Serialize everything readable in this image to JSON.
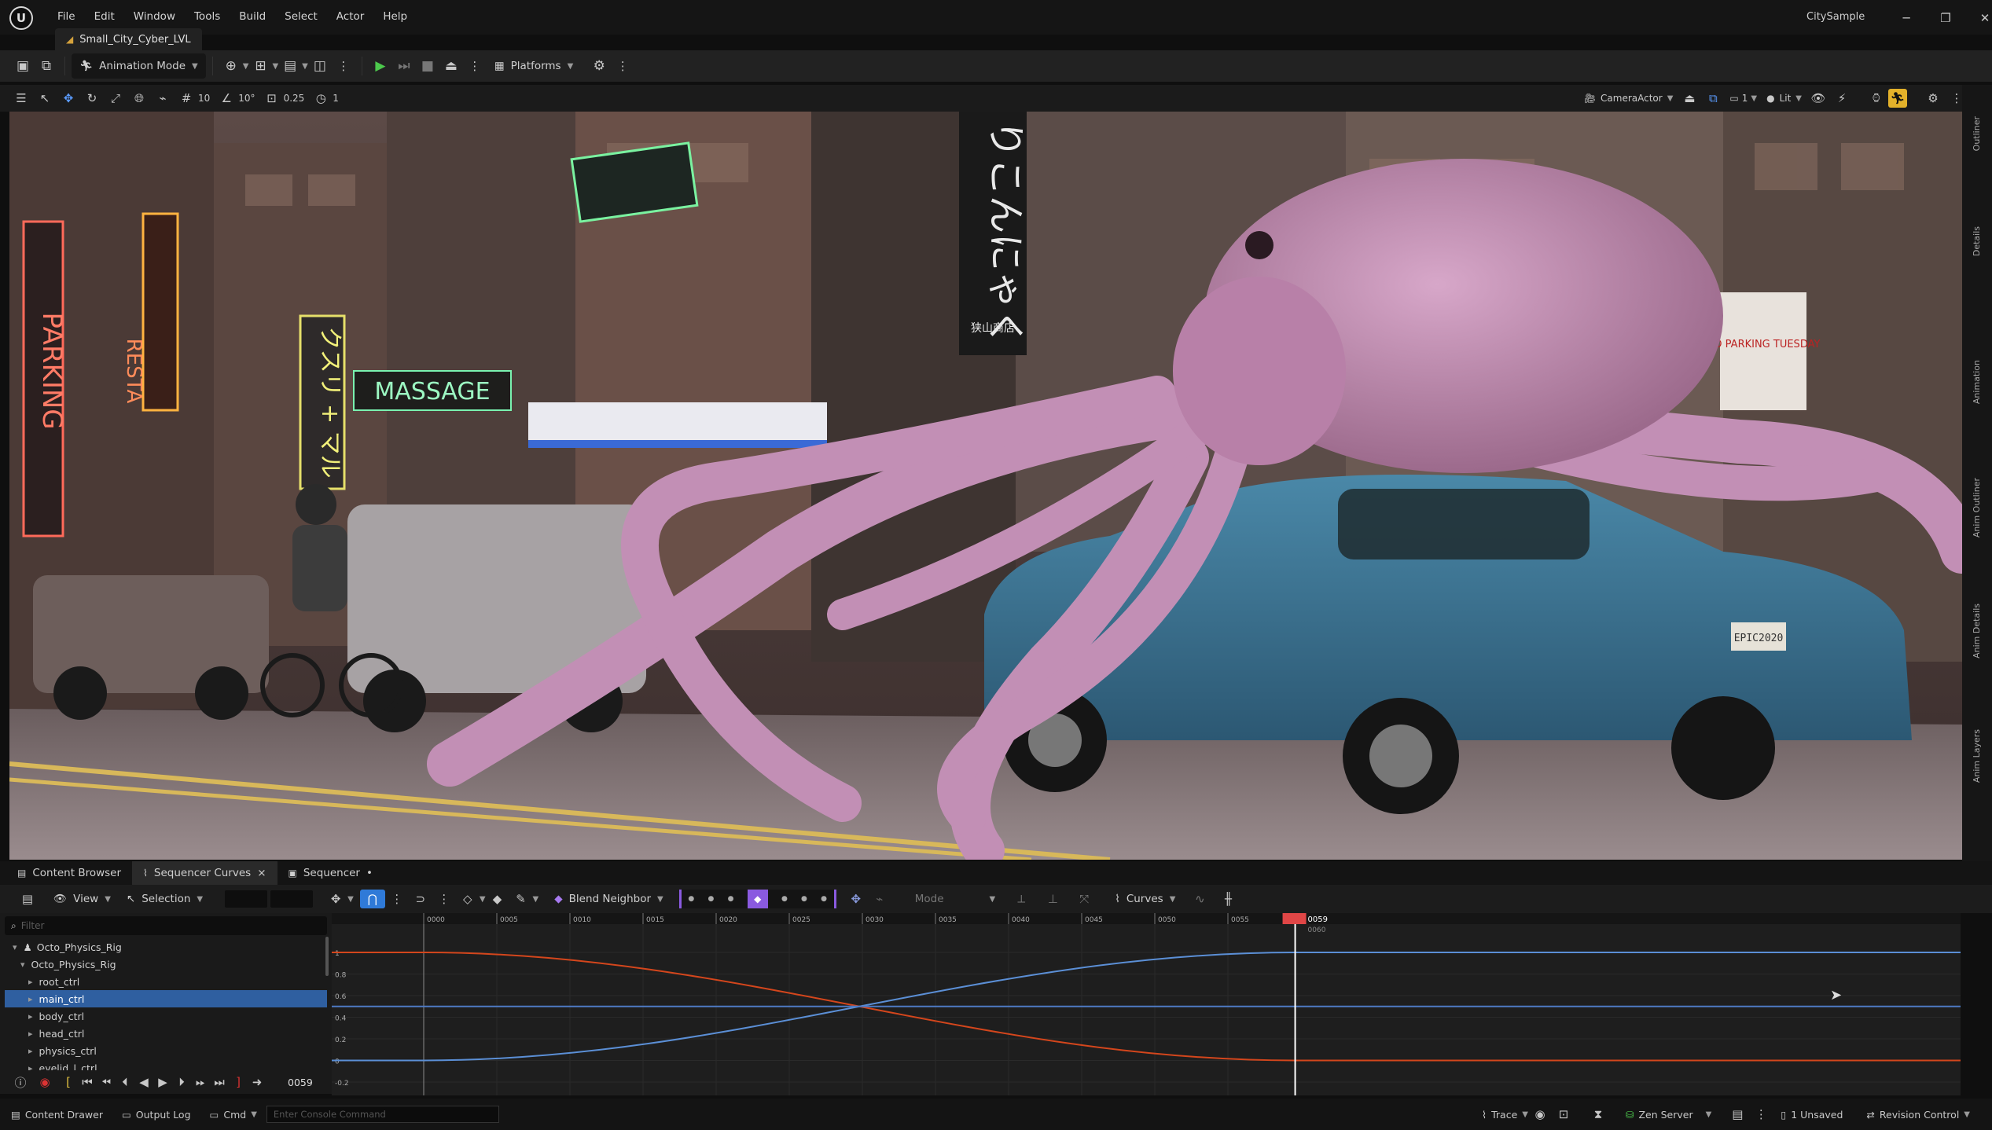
{
  "app": {
    "project_name": "CitySample",
    "level_tab": "Small_City_Cyber_LVL"
  },
  "menu": [
    "File",
    "Edit",
    "Window",
    "Tools",
    "Build",
    "Select",
    "Actor",
    "Help"
  ],
  "toolbar": {
    "mode_label": "Animation Mode",
    "platforms_label": "Platforms"
  },
  "viewport_toolbar": {
    "grid_snap": "10",
    "rot_snap": "10°",
    "scale_snap": "0.25",
    "camera_speed": "1",
    "camera_label": "CameraActor",
    "lit_label": "Lit",
    "cam_count": "1"
  },
  "scene_text": {
    "sign_parking": "PARKING",
    "sign_restaurant": "RESTA",
    "sign_massage": "MASSAGE",
    "sign_kusuri": "クスリ + マル",
    "sign_vertical": "りこんにゃく",
    "sign_shop": "狭山商店",
    "sign_noparking": "NO PARKING TUESDAY",
    "license_plate": "EPIC2020"
  },
  "right_tabs": [
    "Outliner",
    "Details",
    "Animation",
    "Anim Outliner",
    "Anim Details",
    "Anim Layers"
  ],
  "panel_tabs": [
    {
      "label": "Content Browser",
      "closable": false
    },
    {
      "label": "Sequencer Curves",
      "closable": true
    },
    {
      "label": "Sequencer",
      "closable": false
    }
  ],
  "curve_toolbar": {
    "view_label": "View",
    "selection_label": "Selection",
    "interp_label": "Blend Neighbor",
    "mode_label": "Mode",
    "curves_label": "Curves"
  },
  "tree": {
    "filter_placeholder": "Filter",
    "items": [
      {
        "label": "Octo_Physics_Rig",
        "depth": 0,
        "selected": false
      },
      {
        "label": "Octo_Physics_Rig",
        "depth": 1,
        "selected": false
      },
      {
        "label": "root_ctrl",
        "depth": 2,
        "selected": false
      },
      {
        "label": "main_ctrl",
        "depth": 2,
        "selected": true
      },
      {
        "label": "body_ctrl",
        "depth": 2,
        "selected": false
      },
      {
        "label": "head_ctrl",
        "depth": 2,
        "selected": false
      },
      {
        "label": "physics_ctrl",
        "depth": 2,
        "selected": false
      },
      {
        "label": "eyelid_l_ctrl",
        "depth": 2,
        "selected": false
      }
    ]
  },
  "transport": {
    "frame": "0059"
  },
  "curve_editor": {
    "frame_ticks": [
      "0000",
      "0005",
      "0010",
      "0015",
      "0020",
      "0025",
      "0030",
      "0035",
      "0040",
      "0045",
      "0050",
      "0055"
    ],
    "playhead_frame": "0059",
    "playhead_end_label": "0060",
    "y_labels": [
      "1",
      "0.8",
      "0.6",
      "0.4",
      "0.2",
      "0",
      "-0.2"
    ],
    "curves": [
      {
        "name": "orange",
        "color": "#d4461c"
      },
      {
        "name": "blue",
        "color": "#5b8fd6"
      },
      {
        "name": "flat",
        "color": "#4e7ac4"
      }
    ]
  },
  "status": {
    "content_drawer": "Content Drawer",
    "output_log": "Output Log",
    "cmd": "Cmd",
    "console_placeholder": "Enter Console Command",
    "trace": "Trace",
    "zen": "Zen Server",
    "unsaved": "1 Unsaved",
    "revision": "Revision Control"
  },
  "colors": {
    "accent": "#2f7ad8",
    "playhead": "#e04646",
    "selection": "#2f5fa0"
  }
}
